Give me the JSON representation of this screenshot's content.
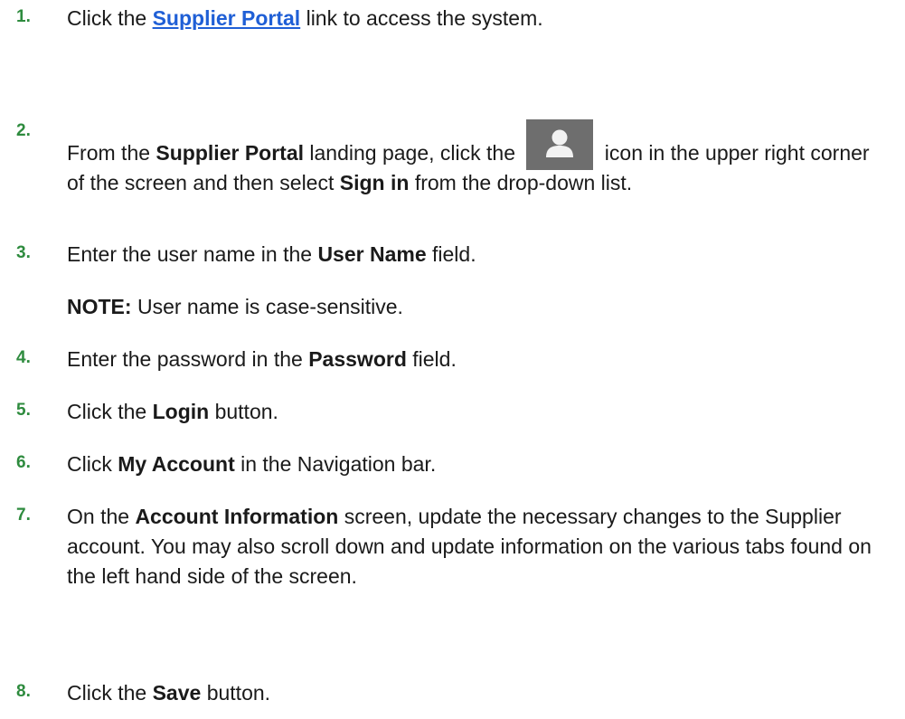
{
  "steps": [
    {
      "num": "1.",
      "before": "Click the ",
      "link": "Supplier Portal",
      "after": " link to access the system."
    },
    {
      "num": "2.",
      "p1": "From the ",
      "b1": "Supplier Portal",
      "p2": " landing page, click the ",
      "icon": "user-avatar-icon",
      "p3": " icon in the upper right corner of the screen and then select ",
      "b2": "Sign in",
      "p4": " from the drop-down list."
    },
    {
      "num": "3.",
      "p1": "Enter the user name in the ",
      "b1": "User Name",
      "p2": " field."
    },
    {
      "note_label": "NOTE:",
      "note_text": " User name is case-sensitive."
    },
    {
      "num": "4.",
      "p1": "Enter the password in the ",
      "b1": "Password",
      "p2": " field."
    },
    {
      "num": "5.",
      "p1": "Click the ",
      "b1": "Login",
      "p2": " button."
    },
    {
      "num": "6.",
      "p1": "Click ",
      "b1": "My Account",
      "p2": " in the Navigation bar."
    },
    {
      "num": "7.",
      "p1": "On the ",
      "b1": "Account Information",
      "p2": " screen, update the necessary changes to the Supplier account. You may also scroll down and update information on the various tabs found on the left hand side of the screen."
    },
    {
      "num": "8.",
      "p1": "Click the ",
      "b1": "Save",
      "p2": " button."
    }
  ],
  "colors": {
    "step_number": "#2e8b3e",
    "link": "#1f5fd6",
    "icon_bg": "#6e6e6e"
  }
}
